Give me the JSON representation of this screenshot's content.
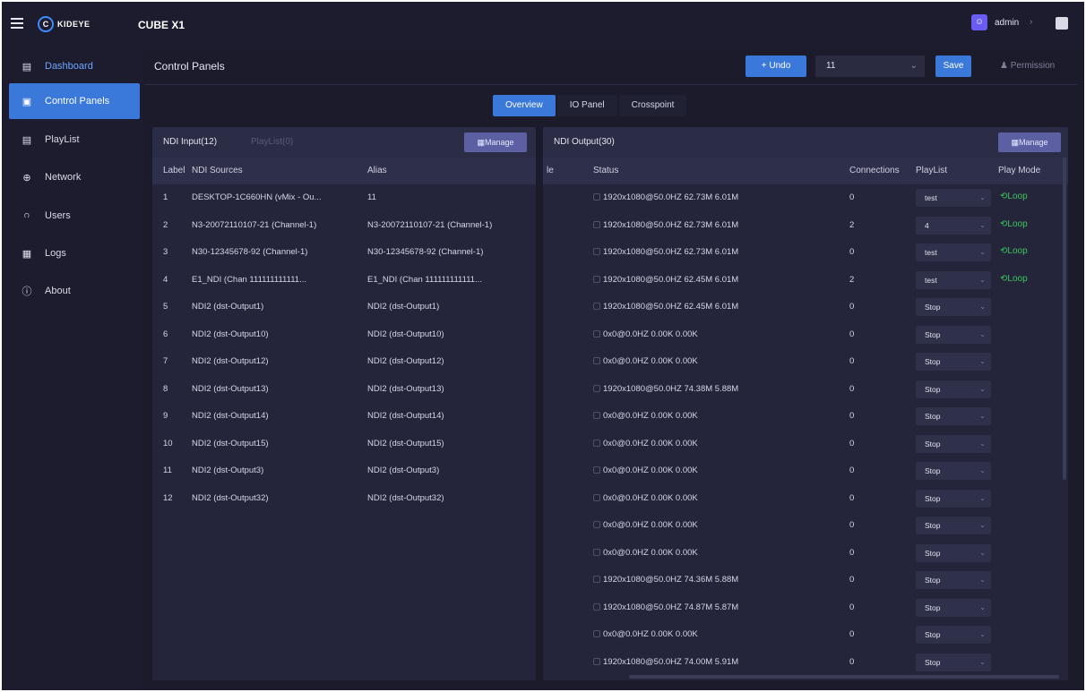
{
  "topbar": {
    "logo_mark": "C",
    "logo_text": "KIDEYE",
    "device": "CUBE X1",
    "user": "admin"
  },
  "sidebar": {
    "items": [
      {
        "label": "Dashboard",
        "icon": "dashboard-icon",
        "glyph": "▤"
      },
      {
        "label": "Control Panels",
        "icon": "control-panel-icon",
        "glyph": "▣"
      },
      {
        "label": "PlayList",
        "icon": "playlist-icon",
        "glyph": "▤"
      },
      {
        "label": "Network",
        "icon": "globe-icon",
        "glyph": "⊕"
      },
      {
        "label": "Users",
        "icon": "users-icon",
        "glyph": "ဂ"
      },
      {
        "label": "Logs",
        "icon": "logs-icon",
        "glyph": "▦"
      },
      {
        "label": "About",
        "icon": "info-icon",
        "glyph": "ⓘ"
      }
    ]
  },
  "header": {
    "title": "Control Panels",
    "undo": "+ Undo",
    "select_value": "11",
    "save": "Save",
    "permission": "♟ Permission"
  },
  "tabs": [
    "Overview",
    "IO Panel",
    "Crosspoint"
  ],
  "input_panel": {
    "tab_active": "NDI Input(12)",
    "tab_dim": "PlayList(0)",
    "manage": "▦Manage",
    "columns": [
      "Label",
      "NDI Sources",
      "Alias"
    ],
    "rows": [
      {
        "n": "1",
        "src": "DESKTOP-1C660HN (vMix - Ou...",
        "alias": "11"
      },
      {
        "n": "2",
        "src": "N3-20072110107-21 (Channel-1)",
        "alias": "N3-20072110107-21 (Channel-1)"
      },
      {
        "n": "3",
        "src": "N30-12345678-92 (Channel-1)",
        "alias": "N30-12345678-92 (Channel-1)"
      },
      {
        "n": "4",
        "src": "E1_NDI (Chan 111111111111...",
        "alias": "E1_NDI (Chan 111111111111..."
      },
      {
        "n": "5",
        "src": "NDI2 (dst-Output1)",
        "alias": "NDI2 (dst-Output1)"
      },
      {
        "n": "6",
        "src": "NDI2 (dst-Output10)",
        "alias": "NDI2 (dst-Output10)"
      },
      {
        "n": "7",
        "src": "NDI2 (dst-Output12)",
        "alias": "NDI2 (dst-Output12)"
      },
      {
        "n": "8",
        "src": "NDI2 (dst-Output13)",
        "alias": "NDI2 (dst-Output13)"
      },
      {
        "n": "9",
        "src": "NDI2 (dst-Output14)",
        "alias": "NDI2 (dst-Output14)"
      },
      {
        "n": "10",
        "src": "NDI2 (dst-Output15)",
        "alias": "NDI2 (dst-Output15)"
      },
      {
        "n": "11",
        "src": "NDI2 (dst-Output3)",
        "alias": "NDI2 (dst-Output3)"
      },
      {
        "n": "12",
        "src": "NDI2 (dst-Output32)",
        "alias": "NDI2 (dst-Output32)"
      }
    ]
  },
  "output_panel": {
    "tab_active": "NDI Output(30)",
    "manage": "▦Manage",
    "columns": [
      "le",
      "Status",
      "Connections",
      "PlayList",
      "Play Mode"
    ],
    "rows": [
      {
        "status": "1920x1080@50.0HZ  62.73M  6.01M",
        "conn": "0",
        "playlist": "test",
        "mode": "Loop"
      },
      {
        "status": "1920x1080@50.0HZ  62.73M  6.01M",
        "conn": "2",
        "playlist": "4",
        "mode": "Loop"
      },
      {
        "status": "1920x1080@50.0HZ  62.73M  6.01M",
        "conn": "0",
        "playlist": "test",
        "mode": "Loop"
      },
      {
        "status": "1920x1080@50.0HZ  62.45M  6.01M",
        "conn": "2",
        "playlist": "test",
        "mode": "Loop"
      },
      {
        "status": "1920x1080@50.0HZ  62.45M  6.01M",
        "conn": "0",
        "playlist": "Stop",
        "mode": ""
      },
      {
        "status": "0x0@0.0HZ  0.00K  0.00K",
        "conn": "0",
        "playlist": "Stop",
        "mode": ""
      },
      {
        "status": "0x0@0.0HZ  0.00K  0.00K",
        "conn": "0",
        "playlist": "Stop",
        "mode": ""
      },
      {
        "status": "1920x1080@50.0HZ  74.38M  5.88M",
        "conn": "0",
        "playlist": "Stop",
        "mode": ""
      },
      {
        "status": "0x0@0.0HZ  0.00K  0.00K",
        "conn": "0",
        "playlist": "Stop",
        "mode": ""
      },
      {
        "status": "0x0@0.0HZ  0.00K  0.00K",
        "conn": "0",
        "playlist": "Stop",
        "mode": ""
      },
      {
        "status": "0x0@0.0HZ  0.00K  0.00K",
        "conn": "0",
        "playlist": "Stop",
        "mode": ""
      },
      {
        "status": "0x0@0.0HZ  0.00K  0.00K",
        "conn": "0",
        "playlist": "Stop",
        "mode": ""
      },
      {
        "status": "0x0@0.0HZ  0.00K  0.00K",
        "conn": "0",
        "playlist": "Stop",
        "mode": ""
      },
      {
        "status": "0x0@0.0HZ  0.00K  0.00K",
        "conn": "0",
        "playlist": "Stop",
        "mode": ""
      },
      {
        "status": "1920x1080@50.0HZ  74.36M  5.88M",
        "conn": "0",
        "playlist": "Stop",
        "mode": ""
      },
      {
        "status": "1920x1080@50.0HZ  74.87M  5.87M",
        "conn": "0",
        "playlist": "Stop",
        "mode": ""
      },
      {
        "status": "0x0@0.0HZ  0.00K  0.00K",
        "conn": "0",
        "playlist": "Stop",
        "mode": ""
      },
      {
        "status": "1920x1080@50.0HZ  74.00M  5.91M",
        "conn": "0",
        "playlist": "Stop",
        "mode": ""
      }
    ]
  },
  "colors": {
    "accent": "#3a78d9",
    "loop": "#3bc65a",
    "background": "#1b1b2c"
  }
}
